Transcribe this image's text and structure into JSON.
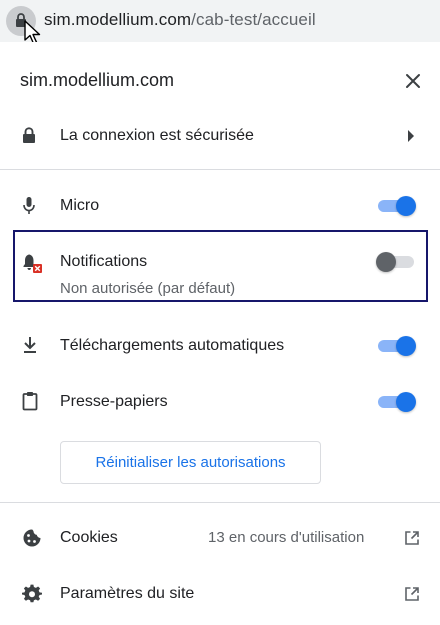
{
  "address_bar": {
    "host": "sim.modellium.com",
    "path": "/cab-test/accueil"
  },
  "panel": {
    "site_title": "sim.modellium.com",
    "connection": {
      "label": "La connexion est sécurisée"
    },
    "permissions": [
      {
        "id": "micro",
        "label": "Micro",
        "enabled": true,
        "icon": "microphone-icon"
      },
      {
        "id": "notifications",
        "label": "Notifications",
        "sublabel": "Non autorisée (par défaut)",
        "enabled": false,
        "icon": "notifications-blocked-icon",
        "highlighted": true
      },
      {
        "id": "downloads",
        "label": "Téléchargements automatiques",
        "enabled": true,
        "icon": "download-icon"
      },
      {
        "id": "clipboard",
        "label": "Presse-papiers",
        "enabled": true,
        "icon": "clipboard-icon"
      }
    ],
    "reset_button_label": "Réinitialiser les autorisations",
    "cookies": {
      "label": "Cookies",
      "status": "13 en cours d'utilisation"
    },
    "site_settings": {
      "label": "Paramètres du site"
    }
  },
  "colors": {
    "accent": "#1a73e8",
    "toggle_track_on": "#8ab4f8",
    "toggle_off_knob": "#5f6368",
    "highlight_border": "#16166b",
    "blocked_badge": "#d93025"
  }
}
